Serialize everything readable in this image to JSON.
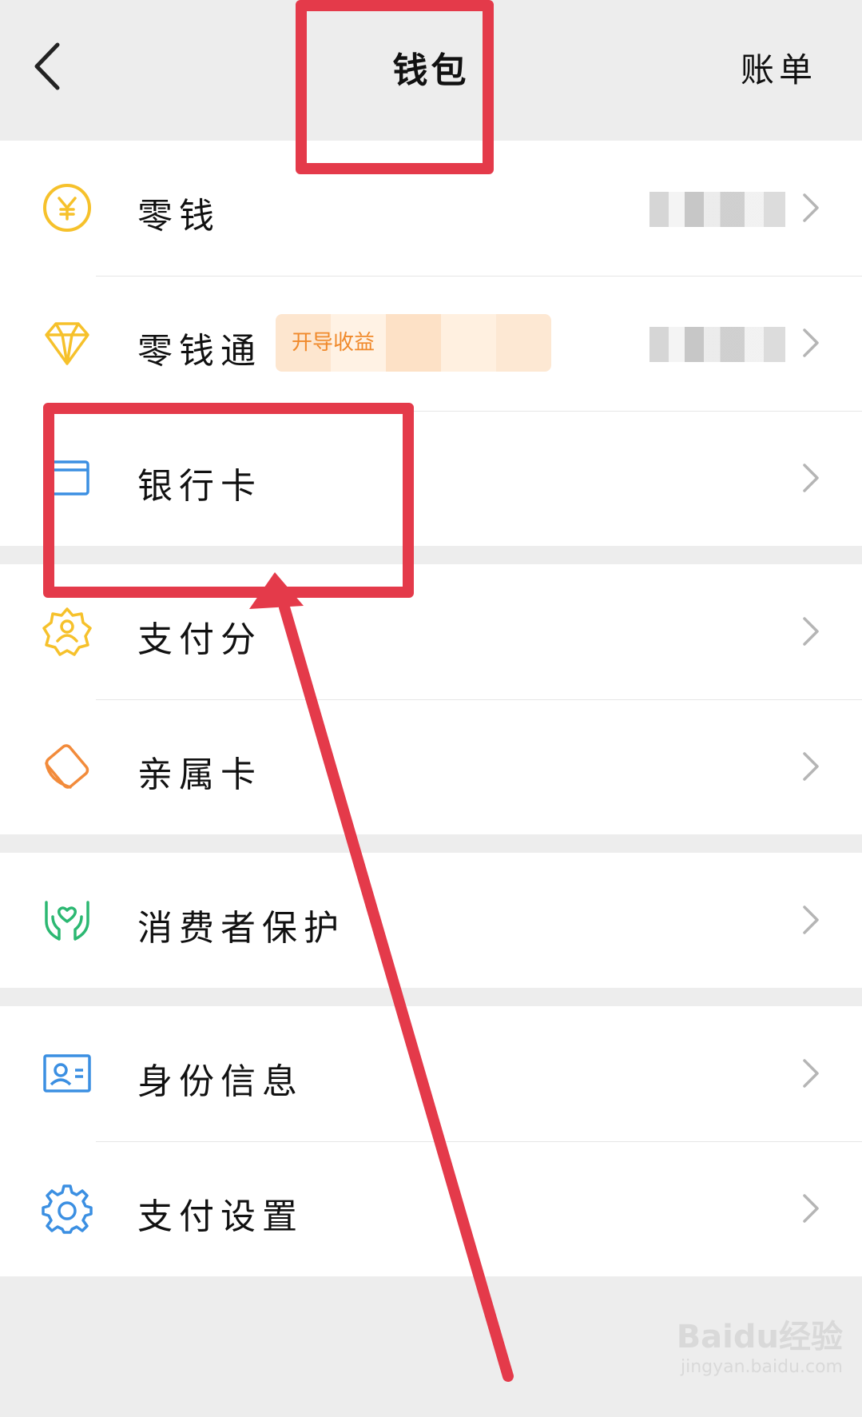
{
  "header": {
    "title": "钱包",
    "bill": "账单"
  },
  "groups": [
    {
      "rows": [
        {
          "label": "零钱",
          "icon": "yuan-coin-icon",
          "color": "#f6c12b"
        },
        {
          "label": "零钱通",
          "icon": "diamond-icon",
          "color": "#f6c12b",
          "promo": "开导收益"
        },
        {
          "label": "银行卡",
          "icon": "bank-card-icon",
          "color": "#3b8fe2"
        }
      ]
    },
    {
      "rows": [
        {
          "label": "支付分",
          "icon": "pay-score-badge-icon",
          "color": "#f6c12b"
        },
        {
          "label": "亲属卡",
          "icon": "family-card-icon",
          "color": "#f28b3b"
        }
      ]
    },
    {
      "rows": [
        {
          "label": "消费者保护",
          "icon": "protection-hands-icon",
          "color": "#2cb872"
        }
      ]
    },
    {
      "rows": [
        {
          "label": "身份信息",
          "icon": "id-card-icon",
          "color": "#3b8fe2"
        },
        {
          "label": "支付设置",
          "icon": "gear-icon",
          "color": "#3b8fe2"
        }
      ]
    }
  ],
  "watermark": {
    "brand": "Baidu经验",
    "site": "jingyan.baidu.com"
  },
  "annotation_color": "#e43a4a"
}
